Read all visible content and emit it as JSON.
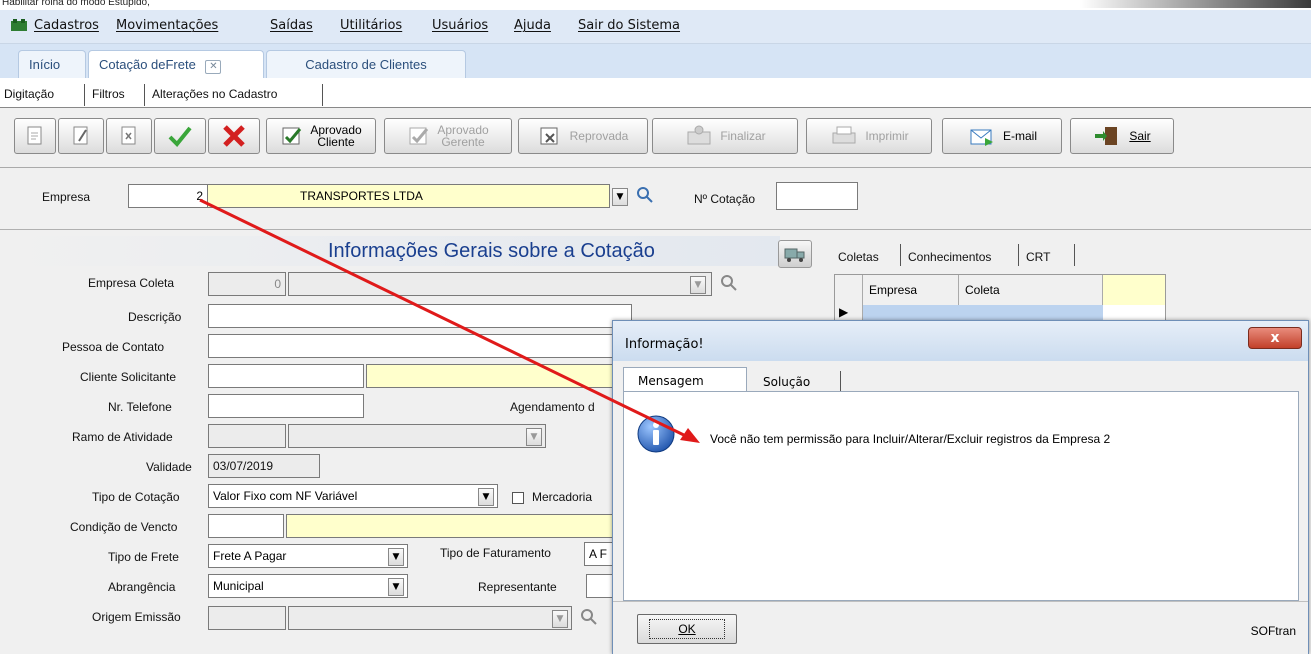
{
  "window": {
    "caption": "Habilitar rolha do modo Estupido,"
  },
  "menu": {
    "items": [
      "Cadastros",
      "Movimentações",
      "Saídas",
      "Utilitários",
      "Usuários",
      "Ajuda",
      "Sair do Sistema"
    ]
  },
  "page_tabs": [
    "Início",
    "Cotação deFrete",
    "Cadastro de Clientes"
  ],
  "sub_tabs": [
    "Digitação",
    "Filtros",
    "Alterações no Cadastro"
  ],
  "toolbar": {
    "aprovado_cliente_1": "Aprovado",
    "aprovado_cliente_2": "Cliente",
    "aprovado_gerente_1": "Aprovado",
    "aprovado_gerente_2": "Gerente",
    "reprovada": "Reprovada",
    "finalizar": "Finalizar",
    "imprimir": "Imprimir",
    "email": "E-mail",
    "sair": "Sair"
  },
  "empresa": {
    "label": "Empresa",
    "code": "2",
    "name": "TRANSPORTES LTDA",
    "cotacao_label": "Nº Cotação",
    "cotacao_value": ""
  },
  "section": {
    "title": "Informações Gerais sobre a Cotação"
  },
  "side_tabs": [
    "Coletas",
    "Conhecimentos",
    "CRT"
  ],
  "side_grid": {
    "columns": [
      "Empresa",
      "Coleta"
    ]
  },
  "form": {
    "empresa_coleta_label": "Empresa Coleta",
    "empresa_coleta_value": "0",
    "descricao_label": "Descrição",
    "pessoa_contato_label": "Pessoa de Contato",
    "cliente_solicitante_label": "Cliente Solicitante",
    "nr_telefone_label": "Nr. Telefone",
    "agendamento_label": "Agendamento d",
    "ramo_atividade_label": "Ramo de Atividade",
    "validade_label": "Validade",
    "validade_value": "03/07/2019",
    "tipo_cotacao_label": "Tipo de Cotação",
    "tipo_cotacao_value": "Valor Fixo com NF Variável",
    "mercadoria_label": "Mercadoria",
    "condicao_vencto_label": "Condição de Vencto",
    "tipo_frete_label": "Tipo de Frete",
    "tipo_frete_value": "Frete A Pagar",
    "tipo_faturamento_label": "Tipo de Faturamento",
    "tipo_faturamento_value": "A F",
    "abrangencia_label": "Abrangência",
    "abrangencia_value": "Municipal",
    "representante_label": "Representante",
    "origem_emissao_label": "Origem Emissão"
  },
  "dialog": {
    "title": "Informação!",
    "close": "x",
    "tabs": [
      "Mensagem",
      "Solução"
    ],
    "message": "Você não tem permissão para Incluir/Alterar/Excluir registros da Empresa 2",
    "ok_label": "OK",
    "brand": "SOFtran"
  },
  "colors": {
    "menu_bg": "#dfe9f6",
    "highlight_yellow": "#ffffcc",
    "arrow": "#e01a1a",
    "info_blue": "#1f5fb8"
  }
}
